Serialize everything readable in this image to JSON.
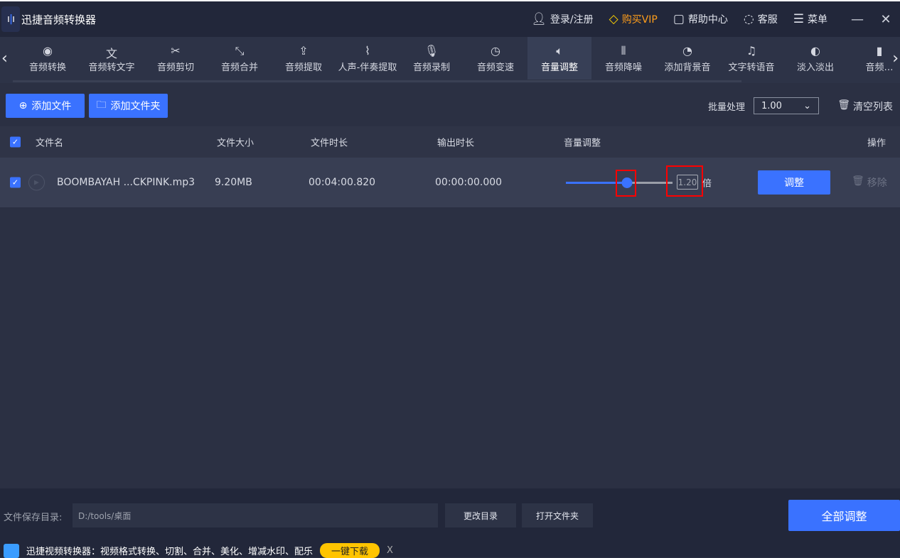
{
  "app": {
    "title": "迅捷音频转换器"
  },
  "titlebar": {
    "login": "登录/注册",
    "vip": "购买VIP",
    "help": "帮助中心",
    "service": "客服",
    "menu": "菜单"
  },
  "nav": {
    "tabs": [
      {
        "label": "音频转换",
        "icon": "waveform-circle-icon"
      },
      {
        "label": "音频转文字",
        "icon": "voice-text-icon"
      },
      {
        "label": "音频剪切",
        "icon": "scissors-icon"
      },
      {
        "label": "音频合并",
        "icon": "merge-icon"
      },
      {
        "label": "音频提取",
        "icon": "upload-icon"
      },
      {
        "label": "人声-伴奏提取",
        "icon": "vocal-extract-icon"
      },
      {
        "label": "音频录制",
        "icon": "microphone-icon"
      },
      {
        "label": "音频变速",
        "icon": "speed-dial-icon"
      },
      {
        "label": "音量调整",
        "icon": "speaker-icon"
      },
      {
        "label": "音频降噪",
        "icon": "noise-bars-icon"
      },
      {
        "label": "添加背景音",
        "icon": "music-disc-icon"
      },
      {
        "label": "文字转语音",
        "icon": "text-speech-icon"
      },
      {
        "label": "淡入淡出",
        "icon": "fade-icon"
      },
      {
        "label": "音频…",
        "icon": "bars-icon"
      }
    ],
    "active": 8
  },
  "toolbar": {
    "add_file": "添加文件",
    "add_folder": "添加文件夹",
    "batch_label": "批量处理",
    "batch_value": "1.00",
    "clear": "清空列表"
  },
  "table": {
    "headers": {
      "name": "文件名",
      "size": "文件大小",
      "duration": "文件时长",
      "output": "输出时长",
      "volume": "音量调整",
      "action": "操作"
    },
    "rows": [
      {
        "name": "BOOMBAYAH ...CKPINK.mp3",
        "size": "9.20MB",
        "duration": "00:04:00.820",
        "output": "00:00:00.000",
        "volume": "1.20",
        "volume_fraction": 0.57,
        "unit": "倍",
        "adjust": "调整",
        "remove": "移除",
        "checked": true
      }
    ]
  },
  "bottom": {
    "save_label": "文件保存目录:",
    "path": "D:/tools/桌面",
    "change_dir": "更改目录",
    "open_folder": "打开文件夹",
    "adjust_all": "全部调整",
    "ad_text": "迅捷视频转换器：视频格式转换、切割、合并、美化、增减水印、配乐",
    "ad_button": "一键下载",
    "ad_close": "X"
  },
  "colors": {
    "accent": "#3a72ff",
    "vip": "#ff9e1b",
    "highlight": "#ff0000"
  }
}
